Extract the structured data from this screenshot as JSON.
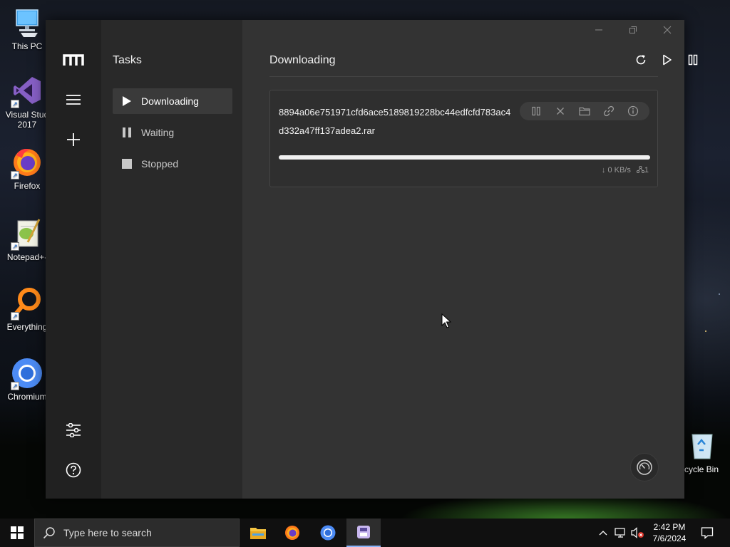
{
  "desktop": {
    "icons": [
      {
        "label": "This PC",
        "icon": "this-pc-icon"
      },
      {
        "label": "Visual Stud 2017",
        "icon": "visual-studio-icon"
      },
      {
        "label": "Firefox",
        "icon": "firefox-icon"
      },
      {
        "label": "Notepad+-",
        "icon": "notepad-plus-plus-icon"
      },
      {
        "label": "Everything",
        "icon": "everything-icon"
      },
      {
        "label": "Chromium",
        "icon": "chromium-icon"
      },
      {
        "label": "cycle Bin",
        "icon": "recycle-bin-icon"
      }
    ]
  },
  "app": {
    "sidebar": {
      "title": "Tasks",
      "items": [
        {
          "label": "Downloading",
          "icon": "play-icon",
          "active": true
        },
        {
          "label": "Waiting",
          "icon": "pause-icon",
          "active": false
        },
        {
          "label": "Stopped",
          "icon": "stop-icon",
          "active": false
        }
      ]
    },
    "main": {
      "heading": "Downloading",
      "toolbar": [
        "refresh-icon",
        "resume-all-icon",
        "pause-all-icon"
      ],
      "task": {
        "name": "8894a06e751971cfd6ace5189819228bc44edfcfd783ac4d332a47ff137adea2.rar",
        "progress": 1.0,
        "speed": "↓ 0 KB/s",
        "connections": "1",
        "actions": [
          "pause-icon",
          "close-icon",
          "folder-icon",
          "link-icon",
          "info-icon"
        ]
      }
    },
    "colors": {
      "rail_bg": "#212121",
      "sidebar_bg": "#292929",
      "main_bg": "#333333",
      "active_item_bg": "#3a3a3a",
      "progress_fill": "#f0f0f0"
    }
  },
  "taskbar": {
    "search_placeholder": "Type here to search",
    "apps": [
      "file-explorer-icon",
      "firefox-icon",
      "chromium-icon",
      "motrix-icon"
    ],
    "time": "2:42 PM",
    "date": "7/6/2024"
  }
}
